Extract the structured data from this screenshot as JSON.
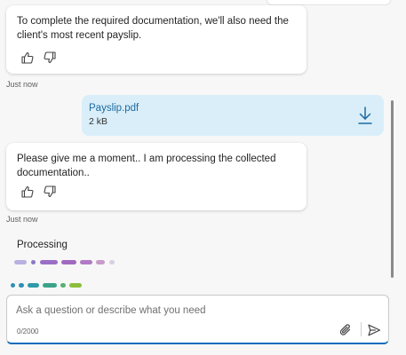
{
  "messages": [
    {
      "text": "To complete the required documentation, we'll also need the client's most recent payslip.",
      "timestamp": "Just now",
      "feedback": {
        "like_icon": "thumbs-up-icon",
        "dislike_icon": "thumbs-down-icon"
      }
    },
    {
      "text": "Please give me a moment.. I am processing the collected documentation..",
      "timestamp": "Just now",
      "feedback": {
        "like_icon": "thumbs-up-icon",
        "dislike_icon": "thumbs-down-icon"
      }
    }
  ],
  "attachment": {
    "file_name": "Payslip.pdf",
    "file_size": "2 kB",
    "icon": "download-icon"
  },
  "status": {
    "label": "Processing"
  },
  "composer": {
    "placeholder": "Ask a question or describe what you need",
    "value": "",
    "counter": "0/2000",
    "attach_icon": "paperclip-icon",
    "send_icon": "send-icon"
  },
  "colors": {
    "accent": "#0f6cbd",
    "file_card_bg": "#d9eef8",
    "file_name": "#1e6aa3",
    "processing_dots": [
      "#b8b0e0",
      "#8a77c8",
      "#9a6fc6",
      "#a06ac0",
      "#b07ac6",
      "#c89ac8",
      "#d8d0e0"
    ],
    "typing_dots": [
      "#2f8fb4",
      "#2f8fb4",
      "#2f9aa8",
      "#3aa38a",
      "#5ab070",
      "#8cbe3c"
    ]
  }
}
